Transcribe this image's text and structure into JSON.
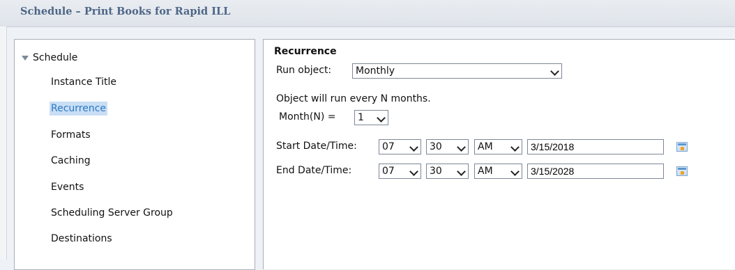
{
  "window": {
    "title": "Schedule – Print Books for Rapid ILL"
  },
  "nav": {
    "root_label": "Schedule",
    "items": [
      {
        "label": "Instance Title",
        "selected": false
      },
      {
        "label": "Recurrence",
        "selected": true
      },
      {
        "label": "Formats",
        "selected": false
      },
      {
        "label": "Caching",
        "selected": false
      },
      {
        "label": "Events",
        "selected": false
      },
      {
        "label": "Scheduling Server Group",
        "selected": false
      },
      {
        "label": "Destinations",
        "selected": false
      }
    ]
  },
  "recurrence": {
    "heading": "Recurrence",
    "run_object_label": "Run object:",
    "run_object_value": "Monthly",
    "description": "Object will run every N months.",
    "month_label": "Month(N) =",
    "month_value": "1",
    "start": {
      "label": "Start Date/Time:",
      "hour": "07",
      "minute": "30",
      "ampm": "AM",
      "date": "3/15/2018"
    },
    "end": {
      "label": "End Date/Time:",
      "hour": "07",
      "minute": "30",
      "ampm": "AM",
      "date": "3/15/2028"
    }
  },
  "colors": {
    "title_text": "#4e6686",
    "selected_bg": "#c9def5",
    "selected_text": "#2a79c4"
  },
  "icons": {
    "calendar": "calendar-icon",
    "dropdown": "chevron-down-icon",
    "tree": "triangle-down-icon"
  }
}
